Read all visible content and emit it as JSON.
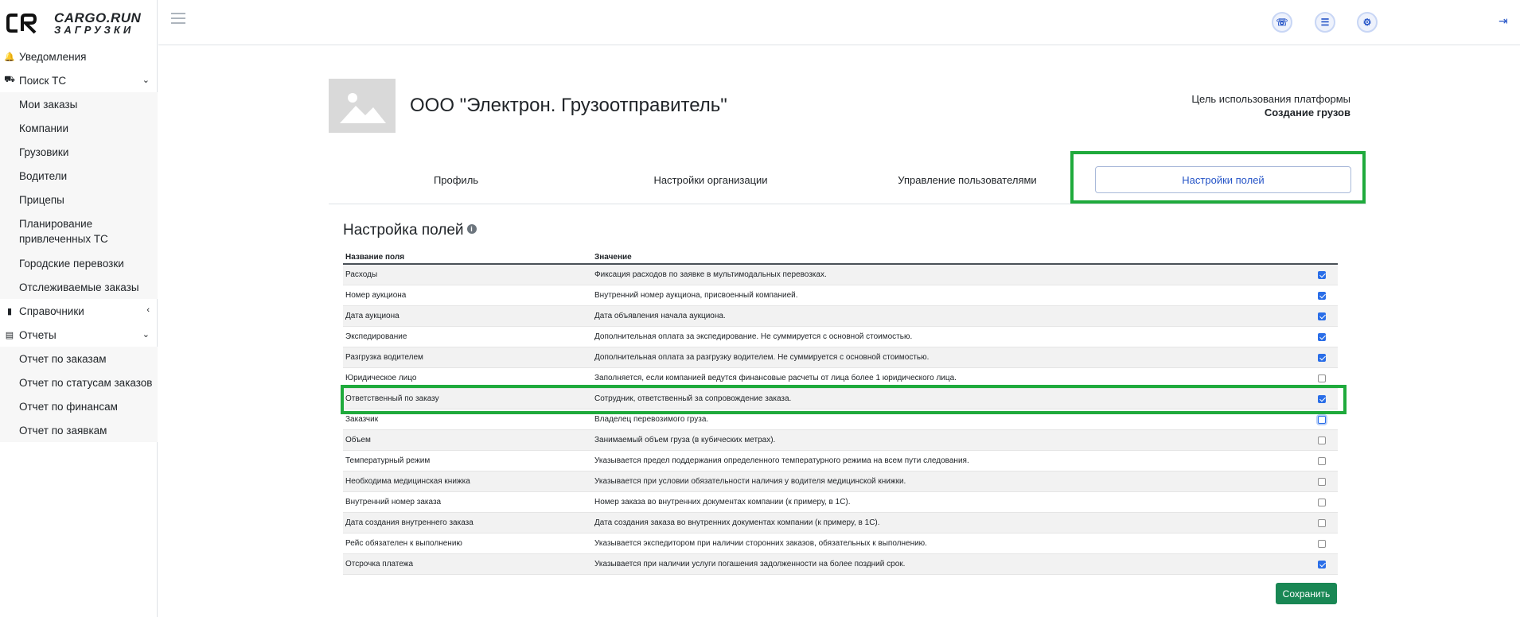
{
  "brand": {
    "line1": "CARGO.RUN",
    "line2": "ЗАГРУЗКИ"
  },
  "sidebar": {
    "notifications": "Уведомления",
    "search": "Поиск ТС",
    "search_items": [
      "Мои заказы",
      "Компании",
      "Грузовики",
      "Водители",
      "Прицепы",
      "Планирование привлеченных ТС",
      "Городские перевозки",
      "Отслеживаемые заказы"
    ],
    "references": "Справочники",
    "reports": "Отчеты",
    "report_items": [
      "Отчет по заказам",
      "Отчет по статусам заказов",
      "Отчет по финансам",
      "Отчет по заявкам"
    ]
  },
  "header": {
    "icons": [
      "support-icon",
      "list-icon",
      "user-settings-icon",
      "logout-icon"
    ]
  },
  "company": {
    "name": "ООО \"Электрон. Грузоотправитель\"",
    "purpose_label": "Цель использования платформы",
    "purpose_value": "Создание грузов"
  },
  "tabs": [
    {
      "label": "Профиль",
      "active": false
    },
    {
      "label": "Настройки организации",
      "active": false
    },
    {
      "label": "Управление пользователями",
      "active": false
    },
    {
      "label": "Настройки полей",
      "active": true
    }
  ],
  "section": {
    "title": "Настройка полей"
  },
  "table": {
    "headers": [
      "Название поля",
      "Значение"
    ],
    "rows": [
      {
        "name": "Расходы",
        "desc": "Фиксация расходов по заявке в мультимодальных перевозках.",
        "checked": true
      },
      {
        "name": "Номер аукциона",
        "desc": "Внутренний номер аукциона, присвоенный компанией.",
        "checked": true
      },
      {
        "name": "Дата аукциона",
        "desc": "Дата объявления начала аукциона.",
        "checked": true
      },
      {
        "name": "Экспедирование",
        "desc": "Дополнительная оплата за экспедирование. Не суммируется с основной стоимостью.",
        "checked": true
      },
      {
        "name": "Разгрузка водителем",
        "desc": "Дополнительная оплата за разгрузку водителем. Не суммируется с основной стоимостью.",
        "checked": true
      },
      {
        "name": "Юридическое лицо",
        "desc": "Заполняется, если компанией ведутся финансовые расчеты от лица более 1 юридического лица.",
        "checked": false
      },
      {
        "name": "Ответственный по заказу",
        "desc": "Сотрудник, ответственный за сопровождение заказа.",
        "checked": true
      },
      {
        "name": "Заказчик",
        "desc": "Владелец перевозимого груза.",
        "checked": false
      },
      {
        "name": "Объем",
        "desc": "Занимаемый объем груза (в кубических метрах).",
        "checked": false
      },
      {
        "name": "Температурный режим",
        "desc": "Указывается предел поддержания определенного температурного режима на всем пути следования.",
        "checked": false
      },
      {
        "name": "Необходима медицинская книжка",
        "desc": "Указывается при условии обязательности наличия у водителя медицинской книжки.",
        "checked": false
      },
      {
        "name": "Внутренний номер заказа",
        "desc": "Номер заказа во внутренних документах компании (к примеру, в 1С).",
        "checked": false
      },
      {
        "name": "Дата создания внутреннего заказа",
        "desc": "Дата создания заказа во внутренних документах компании (к примеру, в 1С).",
        "checked": false
      },
      {
        "name": "Рейс обязателен к выполнению",
        "desc": "Указывается экспедитором при наличии сторонних заказов, обязательных к выполнению.",
        "checked": false
      },
      {
        "name": "Отсрочка платежа",
        "desc": "Указывается при наличии услуги погашения задолженности на более поздний срок.",
        "checked": true
      }
    ]
  },
  "save_label": "Сохранить",
  "colors": {
    "accent": "#2554c7",
    "highlight": "#1faa3c",
    "save": "#198754"
  }
}
